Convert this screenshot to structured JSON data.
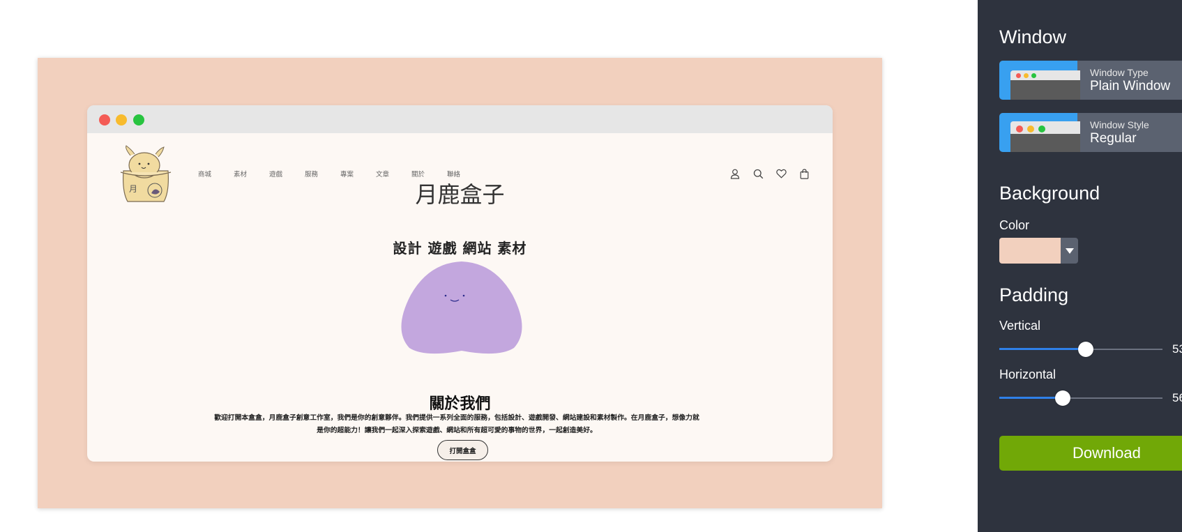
{
  "canvas": {
    "background_color": "#f2d0be",
    "window": {
      "traffic_lights": [
        "#f45b55",
        "#f8bb2d",
        "#28c440"
      ],
      "site": {
        "nav": [
          "商城",
          "素材",
          "遊戲",
          "服務",
          "專案",
          "文章",
          "關於",
          "聯絡"
        ],
        "nav_icons": [
          "user-icon",
          "search-icon",
          "heart-icon",
          "shopping-bag-icon"
        ],
        "title": "月鹿盒子",
        "subtitle": "設計 遊戲 網站 素材",
        "about_title": "關於我們",
        "about_text_line1": "歡迎打開本盒盒，月鹿盒子創意工作室，我們是你的創意夥伴。我們提供一系列全面的服務，包括設計、遊戲開發、網站建設和素材製作。在月鹿盒子，想像力就",
        "about_text_line2": "是你的超能力！讓我們一起深入探索遊戲、網站和所有超可愛的事物的世界，一起創造美好。",
        "open_button": "打開盒盒",
        "blob_color": "#c3a7de"
      }
    }
  },
  "panel": {
    "window_heading": "Window",
    "window_type": {
      "label": "Window Type",
      "value": "Plain Window"
    },
    "window_style": {
      "label": "Window Style",
      "value": "Regular"
    },
    "background_heading": "Background",
    "color_label": "Color",
    "color_value": "#f2d0be",
    "padding_heading": "Padding",
    "vertical": {
      "label": "Vertical",
      "value": "53",
      "fraction": 0.53
    },
    "horizontal": {
      "label": "Horizontal",
      "value": "56",
      "fraction": 0.39
    },
    "download_label": "Download",
    "accent_color": "#2f80e8",
    "download_color": "#71a807"
  }
}
